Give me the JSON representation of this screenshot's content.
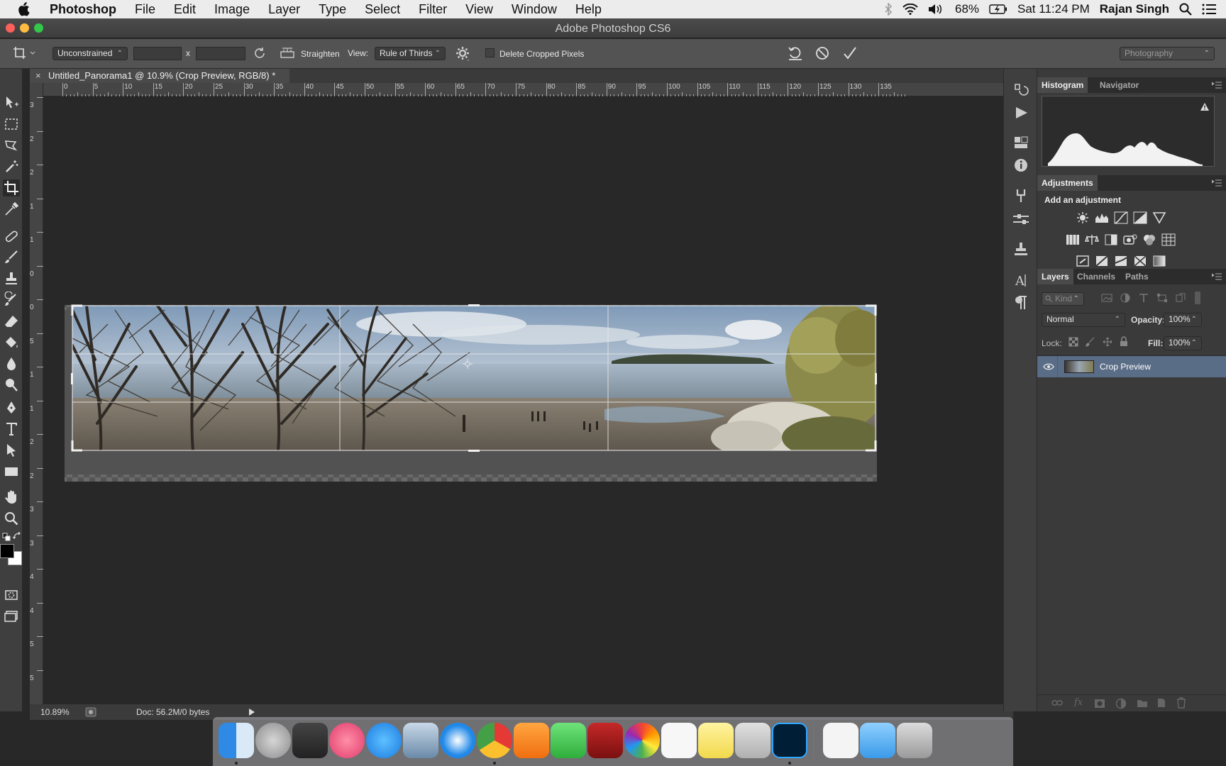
{
  "menubar": {
    "app_name": "Photoshop",
    "items": [
      "File",
      "Edit",
      "Image",
      "Layer",
      "Type",
      "Select",
      "Filter",
      "View",
      "Window",
      "Help"
    ],
    "battery": "68%",
    "clock": "Sat 11:24 PM",
    "user": "Rajan Singh"
  },
  "window": {
    "title": "Adobe Photoshop CS6"
  },
  "options": {
    "ratio": "Unconstrained",
    "x_sep": "x",
    "straighten": "Straighten",
    "view_label": "View:",
    "view_value": "Rule of Thirds",
    "delete_cropped": "Delete Cropped Pixels",
    "workspace": "Photography"
  },
  "document": {
    "tab_close": "×",
    "tab_title": "Untitled_Panorama1 @ 10.9% (Crop Preview, RGB/8) *"
  },
  "ruler": {
    "top_labels": [
      "0",
      "5",
      "10",
      "15",
      "20",
      "25",
      "30",
      "35",
      "40",
      "45",
      "50",
      "55",
      "60",
      "65",
      "70",
      "75",
      "80",
      "85",
      "90",
      "95",
      "100",
      "105",
      "110",
      "115",
      "120",
      "125",
      "130",
      "135"
    ],
    "left_labels": [
      "3",
      "2",
      "2",
      "1",
      "1",
      "0",
      "0",
      "5",
      "1",
      "1",
      "2",
      "2",
      "3",
      "3",
      "4",
      "4",
      "5",
      "5"
    ]
  },
  "status": {
    "zoom": "10.89%",
    "doc": "Doc: 56.2M/0 bytes"
  },
  "histogram": {
    "tab": "Histogram",
    "tab2": "Navigator"
  },
  "adjustments": {
    "tab": "Adjustments",
    "heading": "Add an adjustment"
  },
  "layers": {
    "tabs": [
      "Layers",
      "Channels",
      "Paths"
    ],
    "kind": "Kind",
    "blend_mode": "Normal",
    "opacity_label": "Opacity:",
    "opacity_value": "100%",
    "lock_label": "Lock:",
    "fill_label": "Fill:",
    "fill_value": "100%",
    "layer_name": "Crop Preview"
  },
  "colors": {
    "panel_bg": "#3a3a3a",
    "canvas_bg": "#282828",
    "selected_layer": "#5a6d86"
  }
}
